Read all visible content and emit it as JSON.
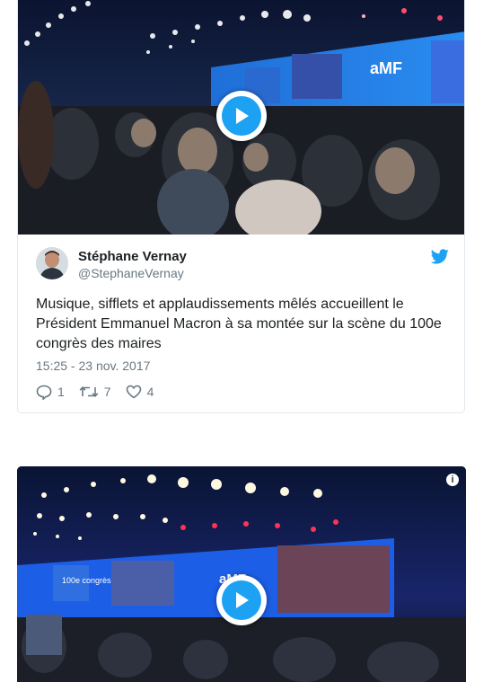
{
  "tweet": {
    "author_name": "Stéphane Vernay",
    "author_handle": "@StephaneVernay",
    "text": "Musique, sifflets et applaudissements mêlés accueillent le Président Emmanuel Macron à sa montée sur la scène du 100e congrès des maires",
    "timestamp": "15:25 - 23 nov. 2017",
    "reply_count": "1",
    "retweet_count": "7",
    "like_count": "4",
    "media_logo_text": "aMF"
  },
  "second_card": {
    "info_label": "i",
    "media_logo_text": "aMF",
    "banner_text": "100e congrès"
  },
  "icons": {
    "play": "play-icon",
    "bird": "twitter-bird-icon",
    "reply": "reply-icon",
    "retweet": "retweet-icon",
    "like": "heart-icon",
    "info": "info-icon"
  },
  "colors": {
    "accent": "#1da1f2",
    "muted_text": "#697882",
    "card_border": "#e1e8ed"
  }
}
